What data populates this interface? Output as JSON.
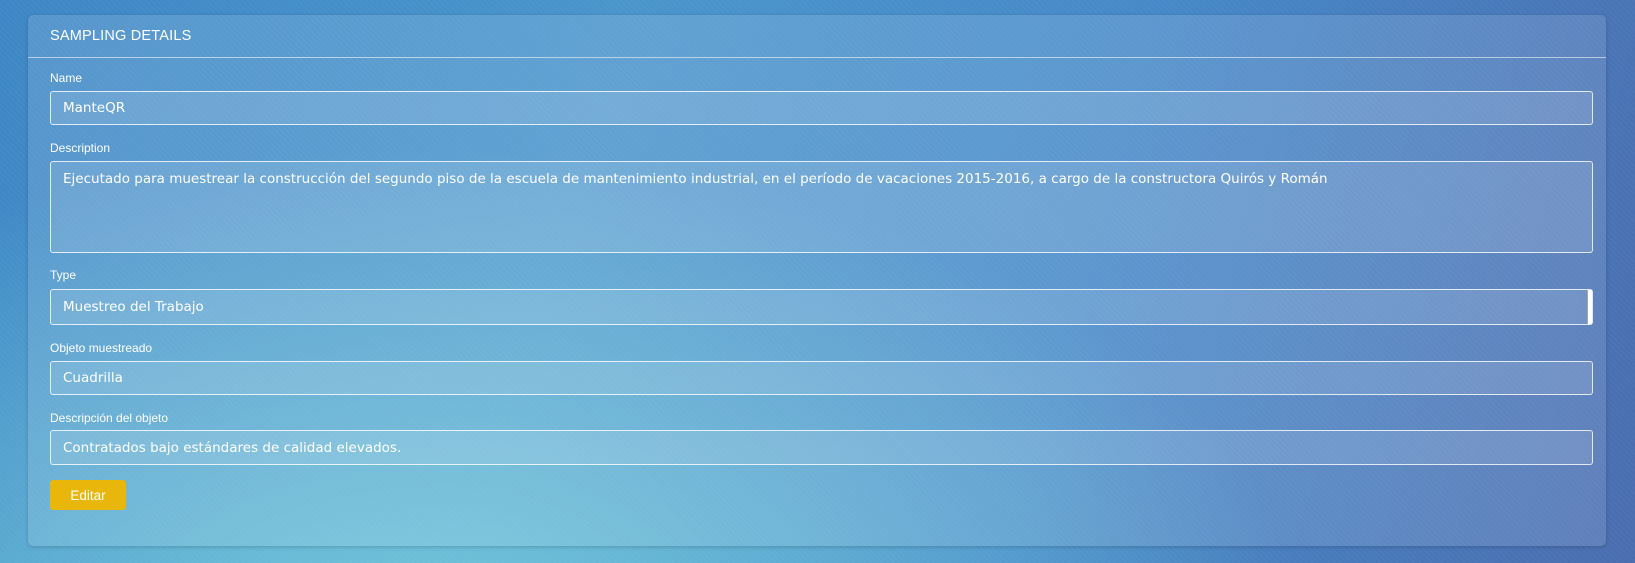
{
  "panel": {
    "title": "SAMPLING DETAILS"
  },
  "fields": {
    "name": {
      "label": "Name",
      "value": "ManteQR"
    },
    "description": {
      "label": "Description",
      "value": "Ejecutado para muestrear la construcción del segundo piso de la escuela de mantenimiento industrial, en el período de vacaciones 2015-2016, a cargo de la constructora Quirós y Román"
    },
    "type": {
      "label": "Type",
      "value": "Muestreo del Trabajo"
    },
    "sampled_object": {
      "label": "Objeto muestreado",
      "value": "Cuadrilla"
    },
    "object_description": {
      "label": "Descripción del objeto",
      "value": "Contratados bajo estándares de calidad elevados."
    }
  },
  "actions": {
    "edit_label": "Editar"
  },
  "colors": {
    "edit_button": "#e9b60c",
    "background_start": "#3e87c6",
    "background_end": "#4a6db0"
  }
}
